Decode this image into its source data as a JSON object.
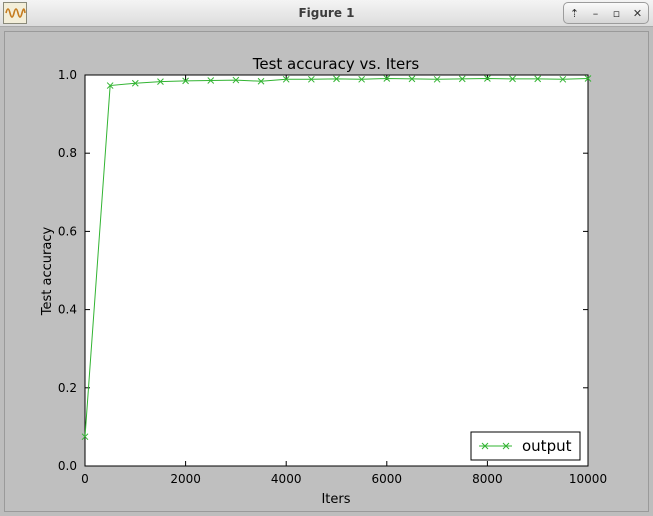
{
  "window": {
    "title": "Figure 1",
    "controls": [
      {
        "name": "keep-above-button",
        "glyph": "⇡"
      },
      {
        "name": "minimize-button",
        "glyph": "–"
      },
      {
        "name": "maximize-button",
        "glyph": "▫"
      },
      {
        "name": "close-button",
        "glyph": "✕"
      }
    ]
  },
  "chart_data": {
    "type": "line",
    "title": "Test accuracy  vs. Iters",
    "xlabel": "Iters",
    "ylabel": "Test accuracy",
    "xlim": [
      0,
      10000
    ],
    "ylim": [
      0.0,
      1.0
    ],
    "xticks": [
      "0",
      "2000",
      "4000",
      "6000",
      "8000",
      "10000"
    ],
    "yticks": [
      "0.0",
      "0.2",
      "0.4",
      "0.6",
      "0.8",
      "1.0"
    ],
    "grid": false,
    "legend_position": "lower-right",
    "series": [
      {
        "name": "output",
        "color": "#32b432",
        "marker": "x",
        "x": [
          0,
          500,
          1000,
          1500,
          2000,
          2500,
          3000,
          3500,
          4000,
          4500,
          5000,
          5500,
          6000,
          6500,
          7000,
          7500,
          8000,
          8500,
          9000,
          9500,
          10000
        ],
        "y": [
          0.075,
          0.973,
          0.979,
          0.983,
          0.985,
          0.986,
          0.987,
          0.984,
          0.989,
          0.989,
          0.99,
          0.989,
          0.991,
          0.99,
          0.989,
          0.99,
          0.991,
          0.99,
          0.99,
          0.989,
          0.991
        ]
      }
    ]
  }
}
